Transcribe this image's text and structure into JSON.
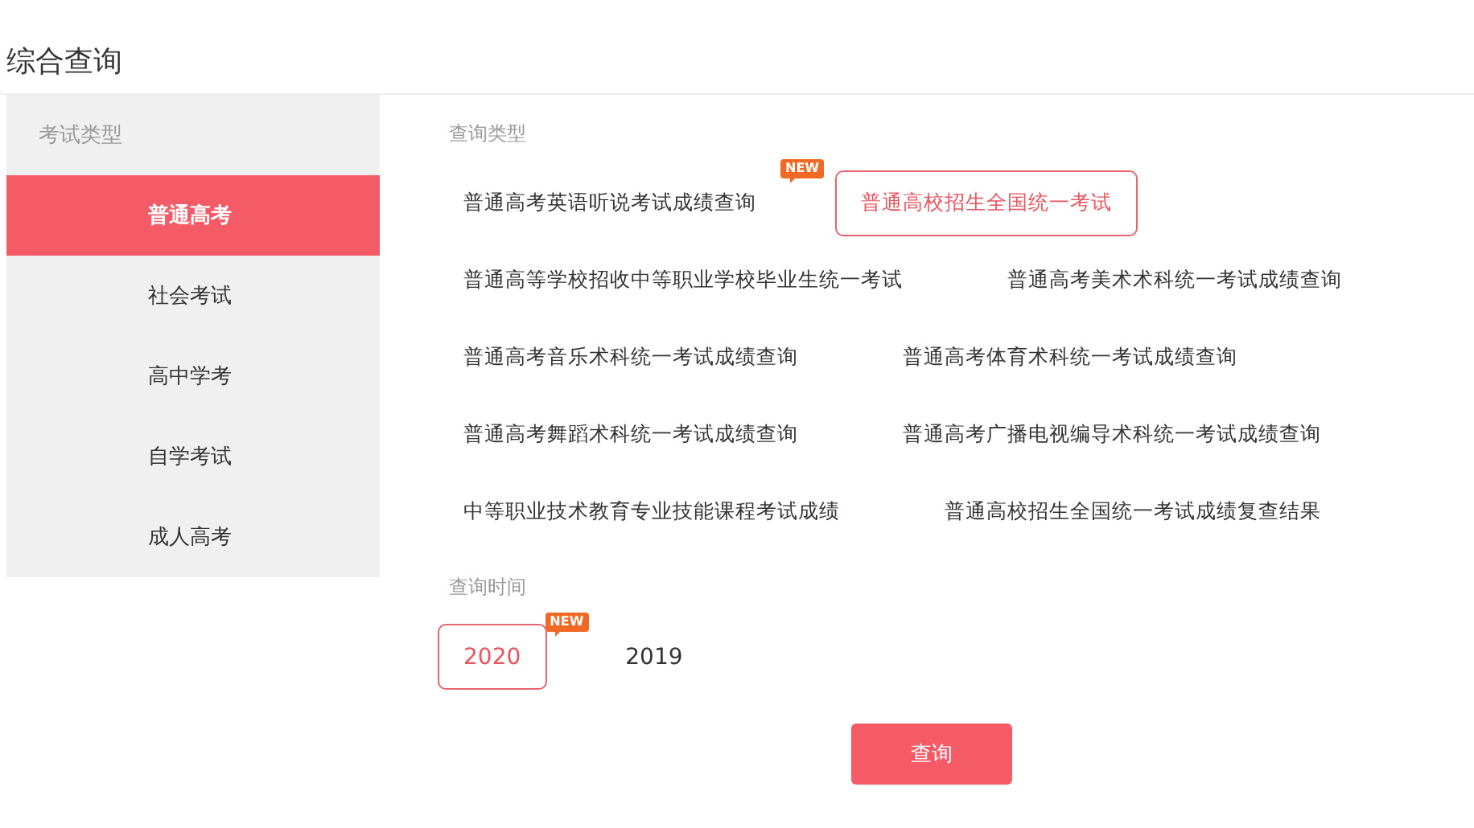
{
  "title": "综合查询",
  "sidebar": {
    "heading": "考试类型",
    "items": [
      {
        "label": "普通高考",
        "selected": true
      },
      {
        "label": "社会考试",
        "selected": false
      },
      {
        "label": "高中学考",
        "selected": false
      },
      {
        "label": "自学考试",
        "selected": false
      },
      {
        "label": "成人高考",
        "selected": false
      }
    ]
  },
  "query_type": {
    "heading": "查询类型",
    "options": [
      {
        "label": "普通高考英语听说考试成绩查询",
        "selected": false,
        "badge": "NEW"
      },
      {
        "label": "普通高校招生全国统一考试",
        "selected": true
      },
      {
        "label": "普通高等学校招收中等职业学校毕业生统一考试",
        "selected": false
      },
      {
        "label": "普通高考美术术科统一考试成绩查询",
        "selected": false
      },
      {
        "label": "普通高考音乐术科统一考试成绩查询",
        "selected": false
      },
      {
        "label": "普通高考体育术科统一考试成绩查询",
        "selected": false
      },
      {
        "label": "普通高考舞蹈术科统一考试成绩查询",
        "selected": false
      },
      {
        "label": "普通高考广播电视编导术科统一考试成绩查询",
        "selected": false
      },
      {
        "label": "中等职业技术教育专业技能课程考试成绩",
        "selected": false
      },
      {
        "label": "普通高校招生全国统一考试成绩复查结果",
        "selected": false
      }
    ]
  },
  "query_time": {
    "heading": "查询时间",
    "options": [
      {
        "label": "2020",
        "selected": true,
        "badge": "NEW"
      },
      {
        "label": "2019",
        "selected": false
      }
    ]
  },
  "submit": "查询"
}
